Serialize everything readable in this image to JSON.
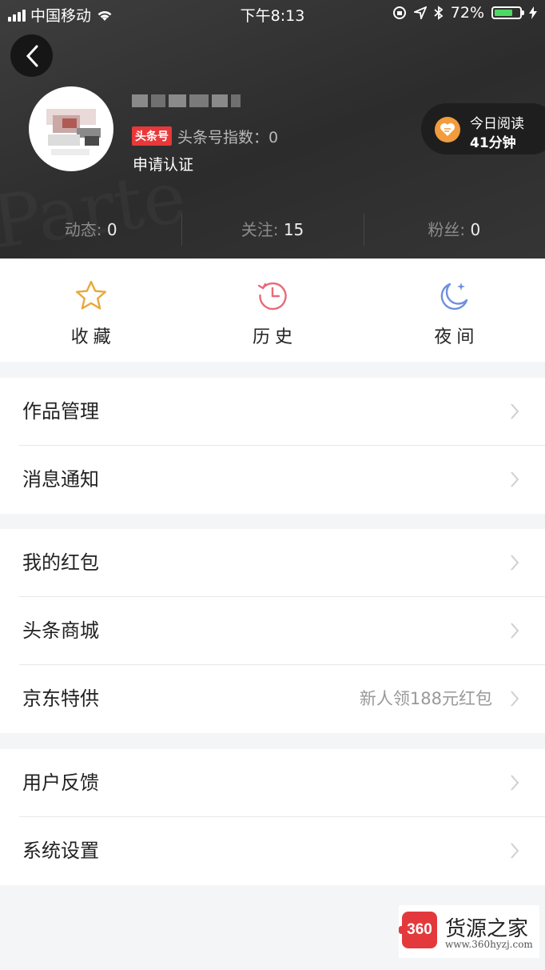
{
  "status_bar": {
    "carrier": "中国移动",
    "time": "下午8:13",
    "battery": "72%",
    "battery_level": 0.72
  },
  "profile": {
    "badge": "头条号",
    "index_label": "头条号指数：0",
    "apply_cert": "申请认证",
    "reading": {
      "line1": "今日阅读",
      "line2": "41分钟"
    }
  },
  "stats": [
    {
      "label": "动态:",
      "value": "0"
    },
    {
      "label": "关注:",
      "value": "15"
    },
    {
      "label": "粉丝:",
      "value": "0"
    }
  ],
  "quick_actions": [
    {
      "label": "收藏",
      "icon": "star-icon",
      "color": "#e8a83a"
    },
    {
      "label": "历史",
      "icon": "history-icon",
      "color": "#e96a7a"
    },
    {
      "label": "夜间",
      "icon": "moon-icon",
      "color": "#6d8fe0"
    }
  ],
  "menu_groups": [
    [
      {
        "label": "作品管理"
      },
      {
        "label": "消息通知"
      }
    ],
    [
      {
        "label": "我的红包"
      },
      {
        "label": "头条商城"
      },
      {
        "label": "京东特供",
        "extra": "新人领188元红包"
      }
    ],
    [
      {
        "label": "用户反馈"
      },
      {
        "label": "系统设置"
      }
    ]
  ],
  "watermark": {
    "logo": "360",
    "title": "货源之家",
    "url": "www.360hyzj.com"
  }
}
